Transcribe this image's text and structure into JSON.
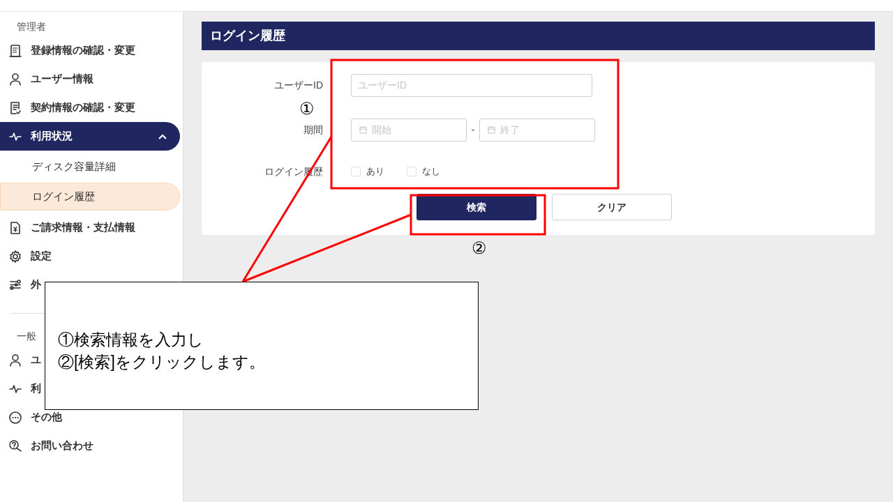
{
  "sidebar": {
    "sections": [
      {
        "heading": "管理者",
        "items": [
          {
            "label": "登録情報の確認・変更",
            "selected": false
          },
          {
            "label": "ユーザー情報",
            "selected": false
          },
          {
            "label": "契約情報の確認・変更",
            "selected": false
          },
          {
            "label": "利用状況",
            "selected": true,
            "expanded": true,
            "children": [
              {
                "label": "ディスク容量詳細",
                "selected": false
              },
              {
                "label": "ログイン履歴",
                "selected": true
              }
            ]
          },
          {
            "label": "ご請求情報・支払情報",
            "selected": false
          },
          {
            "label": "設定",
            "selected": false
          },
          {
            "label": "外",
            "selected": false
          }
        ]
      },
      {
        "heading": "一般",
        "items": [
          {
            "label": "ユ",
            "selected": false
          },
          {
            "label": "利",
            "selected": false
          },
          {
            "label": "その他",
            "selected": false
          },
          {
            "label": "お問い合わせ",
            "selected": false
          }
        ]
      }
    ]
  },
  "page_title": "ログイン履歴",
  "form": {
    "user_id": {
      "label": "ユーザーID",
      "placeholder": "ユーザーID"
    },
    "period": {
      "label": "期間",
      "start_placeholder": "開始",
      "separator": "-",
      "end_placeholder": "終了"
    },
    "login_history": {
      "label": "ログイン履歴",
      "options": [
        {
          "label": "あり",
          "checked": false
        },
        {
          "label": "なし",
          "checked": false
        }
      ]
    },
    "buttons": [
      {
        "label": "検索",
        "kind": "primary"
      },
      {
        "label": "クリア",
        "kind": "secondary"
      }
    ]
  },
  "annotations": {
    "markers": [
      "①",
      "②"
    ],
    "callout": [
      "①検索情報を入力し",
      "②[検索]をクリックします。"
    ]
  }
}
